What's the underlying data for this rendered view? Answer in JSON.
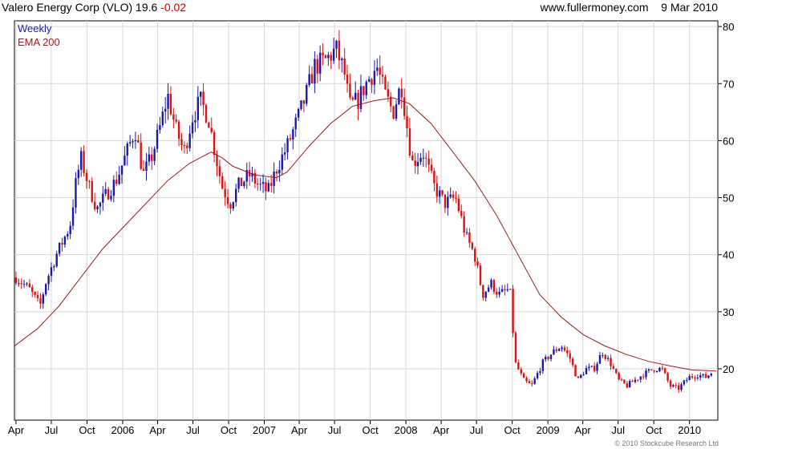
{
  "header": {
    "title": "Valero Energy Corp (VLO)",
    "last": "19.6",
    "change": "-0.02",
    "source": "www.fullermoney.com",
    "date": "9 Mar 2010"
  },
  "copyright": "© 2010 Stockcube Research Ltd",
  "chart_data": {
    "type": "candlestick",
    "title": "Valero Energy Corp (VLO)",
    "interval": "Weekly",
    "legend": [
      {
        "label": "Weekly",
        "color": "#1a1aa8"
      },
      {
        "label": "EMA 200",
        "color": "#9b1b1b"
      }
    ],
    "legend_position": "top-left",
    "y_axis_position": "right",
    "ylim": [
      11,
      81
    ],
    "y_ticks": [
      20,
      30,
      40,
      50,
      60,
      70,
      80
    ],
    "x_range": [
      "2005-03-28",
      "2010-03-15"
    ],
    "x_ticks": [
      {
        "label": "Apr",
        "date": "2005-04-01"
      },
      {
        "label": "Jul",
        "date": "2005-07-01"
      },
      {
        "label": "Oct",
        "date": "2005-10-01"
      },
      {
        "label": "2006",
        "date": "2006-01-01"
      },
      {
        "label": "Apr",
        "date": "2006-04-01"
      },
      {
        "label": "Jul",
        "date": "2006-07-01"
      },
      {
        "label": "Oct",
        "date": "2006-10-01"
      },
      {
        "label": "2007",
        "date": "2007-01-01"
      },
      {
        "label": "Apr",
        "date": "2007-04-01"
      },
      {
        "label": "Jul",
        "date": "2007-07-01"
      },
      {
        "label": "Oct",
        "date": "2007-10-01"
      },
      {
        "label": "2008",
        "date": "2008-01-01"
      },
      {
        "label": "Apr",
        "date": "2008-04-01"
      },
      {
        "label": "Jul",
        "date": "2008-07-01"
      },
      {
        "label": "Oct",
        "date": "2008-10-01"
      },
      {
        "label": "2009",
        "date": "2009-01-01"
      },
      {
        "label": "Apr",
        "date": "2009-04-01"
      },
      {
        "label": "Jul",
        "date": "2009-07-01"
      },
      {
        "label": "Oct",
        "date": "2009-10-01"
      },
      {
        "label": "2010",
        "date": "2010-01-01"
      }
    ],
    "colors": {
      "up": "#1a1aa8",
      "down": "#dd1111",
      "ema": "#9b1b1b",
      "grid": "#d6d6d6"
    },
    "price_path": [
      [
        "2005-04-01",
        36
      ],
      [
        "2005-05-05",
        34
      ],
      [
        "2005-06-02",
        31
      ],
      [
        "2005-06-16",
        35
      ],
      [
        "2005-07-14",
        40
      ],
      [
        "2005-08-18",
        45
      ],
      [
        "2005-09-01",
        52
      ],
      [
        "2005-09-15",
        57
      ],
      [
        "2005-10-06",
        52
      ],
      [
        "2005-10-27",
        48
      ],
      [
        "2005-11-24",
        51
      ],
      [
        "2005-12-15",
        53
      ],
      [
        "2006-01-12",
        58
      ],
      [
        "2006-02-02",
        62
      ],
      [
        "2006-02-23",
        54
      ],
      [
        "2006-03-16",
        57
      ],
      [
        "2006-04-06",
        62
      ],
      [
        "2006-04-27",
        68
      ],
      [
        "2006-05-18",
        62
      ],
      [
        "2006-06-08",
        58
      ],
      [
        "2006-06-29",
        64
      ],
      [
        "2006-07-20",
        67
      ],
      [
        "2006-08-10",
        64
      ],
      [
        "2006-08-24",
        59
      ],
      [
        "2006-09-14",
        52
      ],
      [
        "2006-10-05",
        49
      ],
      [
        "2006-10-26",
        52
      ],
      [
        "2006-11-23",
        54
      ],
      [
        "2006-12-21",
        52
      ],
      [
        "2007-01-11",
        51
      ],
      [
        "2007-02-01",
        55
      ],
      [
        "2007-03-01",
        59
      ],
      [
        "2007-03-29",
        64
      ],
      [
        "2007-04-19",
        68
      ],
      [
        "2007-05-10",
        73
      ],
      [
        "2007-06-07",
        74
      ],
      [
        "2007-07-05",
        76
      ],
      [
        "2007-07-26",
        72
      ],
      [
        "2007-08-09",
        66
      ],
      [
        "2007-08-30",
        67
      ],
      [
        "2007-09-20",
        70
      ],
      [
        "2007-10-18",
        73
      ],
      [
        "2007-11-08",
        68
      ],
      [
        "2007-11-29",
        65
      ],
      [
        "2007-12-20",
        70
      ],
      [
        "2008-01-17",
        56
      ],
      [
        "2008-02-14",
        58
      ],
      [
        "2008-03-13",
        52
      ],
      [
        "2008-04-10",
        49
      ],
      [
        "2008-05-08",
        50
      ],
      [
        "2008-06-05",
        43
      ],
      [
        "2008-06-26",
        40
      ],
      [
        "2008-07-17",
        33
      ],
      [
        "2008-08-07",
        35
      ],
      [
        "2008-08-28",
        33
      ],
      [
        "2008-09-25",
        34
      ],
      [
        "2008-10-09",
        21
      ],
      [
        "2008-10-30",
        18
      ],
      [
        "2008-11-20",
        17
      ],
      [
        "2008-12-18",
        21
      ],
      [
        "2009-01-15",
        23
      ],
      [
        "2009-02-05",
        24
      ],
      [
        "2009-02-26",
        22
      ],
      [
        "2009-03-19",
        18
      ],
      [
        "2009-04-09",
        20
      ],
      [
        "2009-04-30",
        20
      ],
      [
        "2009-05-21",
        23
      ],
      [
        "2009-06-11",
        21
      ],
      [
        "2009-07-02",
        18
      ],
      [
        "2009-07-23",
        17
      ],
      [
        "2009-08-13",
        18
      ],
      [
        "2009-09-03",
        19
      ],
      [
        "2009-10-01",
        20
      ],
      [
        "2009-10-22",
        20
      ],
      [
        "2009-11-12",
        17
      ],
      [
        "2009-12-03",
        16.5
      ],
      [
        "2009-12-31",
        18.5
      ],
      [
        "2010-01-21",
        19
      ],
      [
        "2010-02-11",
        18.5
      ],
      [
        "2010-03-04",
        19.6
      ]
    ],
    "ema_200": [
      [
        "2005-03-28",
        24
      ],
      [
        "2005-05-26",
        27
      ],
      [
        "2005-07-21",
        31
      ],
      [
        "2005-09-15",
        36
      ],
      [
        "2005-11-10",
        41
      ],
      [
        "2006-01-05",
        45
      ],
      [
        "2006-03-02",
        49
      ],
      [
        "2006-04-27",
        53
      ],
      [
        "2006-06-22",
        56
      ],
      [
        "2006-08-17",
        58
      ],
      [
        "2006-09-14",
        57
      ],
      [
        "2006-10-12",
        55.5
      ],
      [
        "2006-12-07",
        54
      ],
      [
        "2007-02-01",
        53.5
      ],
      [
        "2007-03-01",
        54.5
      ],
      [
        "2007-04-26",
        59
      ],
      [
        "2007-06-21",
        63
      ],
      [
        "2007-08-16",
        66
      ],
      [
        "2007-10-11",
        67
      ],
      [
        "2007-11-29",
        67.5
      ],
      [
        "2008-01-10",
        66.5
      ],
      [
        "2008-03-06",
        63
      ],
      [
        "2008-05-01",
        58
      ],
      [
        "2008-06-26",
        53
      ],
      [
        "2008-08-21",
        47
      ],
      [
        "2008-10-16",
        40
      ],
      [
        "2008-12-11",
        33
      ],
      [
        "2009-02-05",
        29
      ],
      [
        "2009-04-02",
        26
      ],
      [
        "2009-05-28",
        24
      ],
      [
        "2009-07-23",
        22.5
      ],
      [
        "2009-09-17",
        21.3
      ],
      [
        "2009-11-12",
        20.5
      ],
      [
        "2010-01-07",
        19.8
      ],
      [
        "2010-03-11",
        19.6
      ]
    ]
  }
}
